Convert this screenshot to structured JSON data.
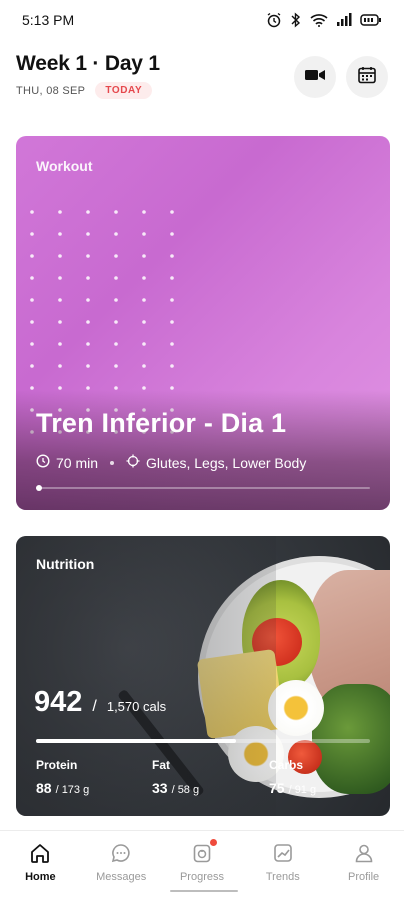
{
  "status_bar": {
    "time": "5:13 PM",
    "icons": [
      "alarm-icon",
      "bluetooth-icon",
      "wifi-icon",
      "signal-icon",
      "battery-icon"
    ]
  },
  "header": {
    "title": "Week 1 · Day 1",
    "date": "THU, 08 SEP",
    "today_badge": "TODAY",
    "buttons": [
      "video-icon",
      "calendar-icon"
    ]
  },
  "workout": {
    "label": "Workout",
    "title": "Tren Inferior - Dia 1",
    "duration": "70 min",
    "muscles": "Glutes, Legs, Lower Body",
    "colors": {
      "gradient_start": "#d177d8",
      "gradient_end": "#e093e3"
    }
  },
  "nutrition": {
    "label": "Nutrition",
    "calories": "942",
    "calorie_slash": "/",
    "calorie_target": "1,570 cals",
    "calorie_progress": 0.6,
    "macros": [
      {
        "label": "Protein",
        "value": "88",
        "target": "/ 173 g"
      },
      {
        "label": "Fat",
        "value": "33",
        "target": "/ 58 g"
      },
      {
        "label": "Carbs",
        "value": "75",
        "target": "/ 91 g"
      }
    ]
  },
  "bottom_nav": {
    "items": [
      {
        "label": "Home",
        "icon": "home-icon",
        "active": true
      },
      {
        "label": "Messages",
        "icon": "messages-icon",
        "active": false
      },
      {
        "label": "Progress",
        "icon": "progress-icon",
        "active": false,
        "badge": true
      },
      {
        "label": "Trends",
        "icon": "trends-icon",
        "active": false
      },
      {
        "label": "Profile",
        "icon": "profile-icon",
        "active": false
      }
    ],
    "badge_color": "#ef4b3c"
  }
}
